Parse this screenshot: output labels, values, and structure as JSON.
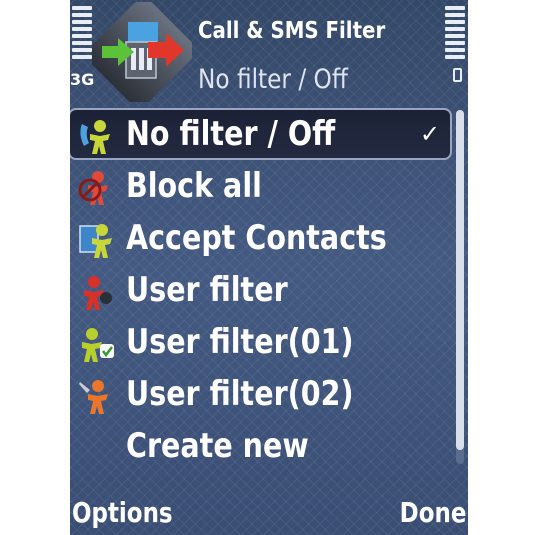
{
  "status": {
    "network": "3G"
  },
  "header": {
    "title": "Call & SMS Filter",
    "status": "No filter / Off"
  },
  "list": {
    "items": [
      {
        "label": "No filter / Off",
        "icon": "person-phone-icon",
        "selected": true
      },
      {
        "label": "Block all",
        "icon": "block-all-icon"
      },
      {
        "label": "Accept Contacts",
        "icon": "contacts-icon"
      },
      {
        "label": "User filter",
        "icon": "user-filter-icon"
      },
      {
        "label": "User filter(01)",
        "icon": "user-filter-check-icon"
      },
      {
        "label": "User filter(02)",
        "icon": "user-filter-tool-icon"
      },
      {
        "label": "Create new"
      }
    ],
    "selected_mark": "✓"
  },
  "softkeys": {
    "left": "Options",
    "right": "Done"
  },
  "colors": {
    "background": "#3c5178",
    "selection": "#1c2236",
    "text": "#ffffff"
  }
}
